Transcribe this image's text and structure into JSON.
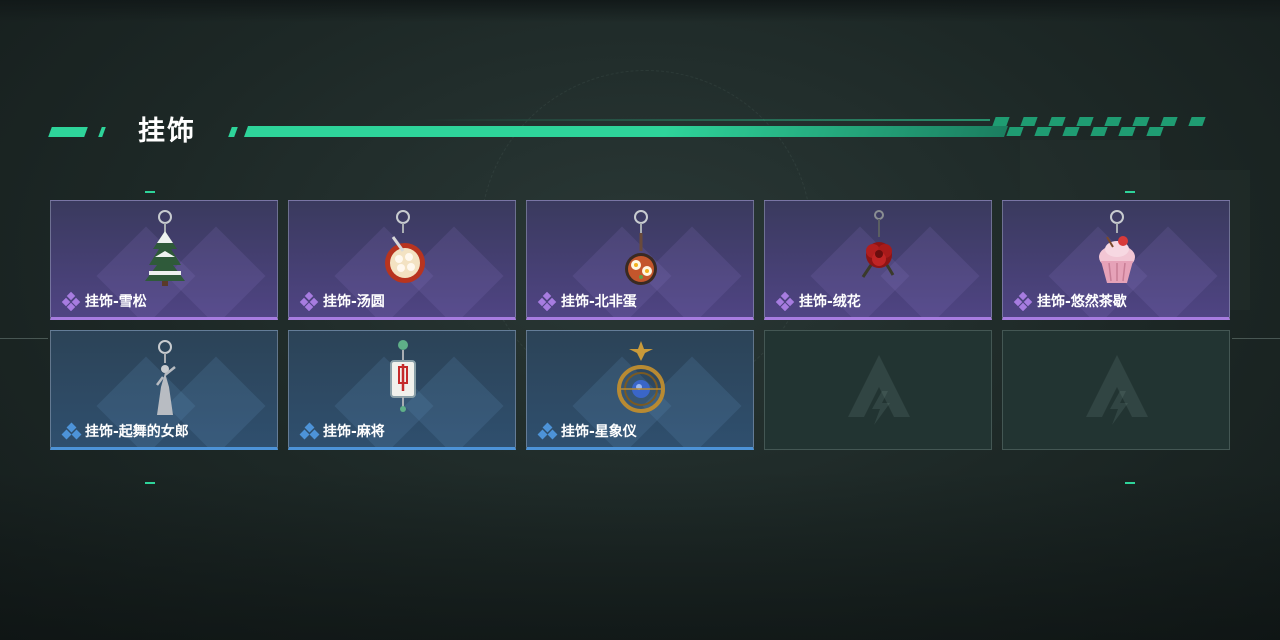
{
  "section": {
    "title": "挂饰",
    "accent_color": "#2ed49a"
  },
  "colors": {
    "rare_purple": "#a77ce0",
    "rare_blue": "#4d93d8"
  },
  "items": [
    {
      "label": "挂饰-雪松",
      "rarity": "purple",
      "icon": "snow-pine-tree-charm-icon"
    },
    {
      "label": "挂饰-汤圆",
      "rarity": "purple",
      "icon": "tangyuan-bowl-charm-icon"
    },
    {
      "label": "挂饰-北非蛋",
      "rarity": "purple",
      "icon": "shakshuka-pan-charm-icon"
    },
    {
      "label": "挂饰-绒花",
      "rarity": "purple",
      "icon": "velvet-flower-charm-icon"
    },
    {
      "label": "挂饰-悠然茶歇",
      "rarity": "purple",
      "icon": "cupcake-charm-icon"
    },
    {
      "label": "挂饰-起舞的女郎",
      "rarity": "blue",
      "icon": "dancing-lady-charm-icon"
    },
    {
      "label": "挂饰-麻将",
      "rarity": "blue",
      "icon": "mahjong-tile-charm-icon"
    },
    {
      "label": "挂饰-星象仪",
      "rarity": "blue",
      "icon": "astrolabe-charm-icon"
    },
    {
      "label": "",
      "rarity": "empty",
      "icon": "game-logo-placeholder-icon"
    },
    {
      "label": "",
      "rarity": "empty",
      "icon": "game-logo-placeholder-icon"
    }
  ]
}
